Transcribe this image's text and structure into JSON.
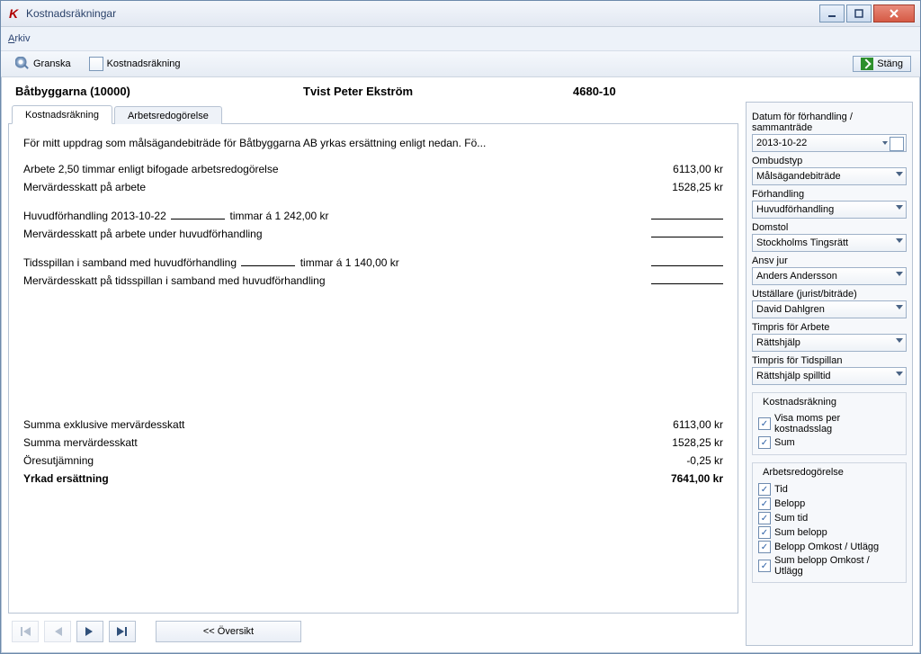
{
  "window": {
    "title": "Kostnadsräkningar"
  },
  "menu": {
    "arkiv": "Arkiv"
  },
  "toolbar": {
    "granska": "Granska",
    "kostnadsrakning": "Kostnadsräkning",
    "stang": "Stäng"
  },
  "header": {
    "client": "Båtbyggarna (10000)",
    "case": "Tvist Peter Ekström",
    "caseno": "4680-10"
  },
  "tabs": {
    "t1": "Kostnadsräkning",
    "t2": "Arbetsredogörelse"
  },
  "doc": {
    "intro": "För mitt uppdrag som målsägandebiträde för Båtbyggarna AB yrkas ersättning enligt nedan. Fö...",
    "r1l": "Arbete 2,50 timmar enligt bifogade arbetsredogörelse",
    "r1a": "6113,00 kr",
    "r2l": "Mervärdesskatt på arbete",
    "r2a": "1528,25 kr",
    "r3l_a": "Huvudförhandling 2013-10-22",
    "r3l_b": "timmar á 1 242,00 kr",
    "r4l": "Mervärdesskatt på arbete under huvudförhandling",
    "r5l_a": "Tidsspillan i samband med huvudförhandling",
    "r5l_b": "timmar á 1 140,00 kr",
    "r6l": "Mervärdesskatt på tidsspillan i samband med huvudförhandling",
    "s1l": "Summa exklusive mervärdesskatt",
    "s1a": "6113,00 kr",
    "s2l": "Summa mervärdesskatt",
    "s2a": "1528,25 kr",
    "s3l": "Öresutjämning",
    "s3a": "-0,25 kr",
    "s4l": "Yrkad ersättning",
    "s4a": "7641,00 kr"
  },
  "bottom": {
    "oversikt": "<< Översikt"
  },
  "side": {
    "lbl_datum": "Datum för förhandling / sammanträde",
    "val_datum": "2013-10-22",
    "lbl_ombud": "Ombudstyp",
    "val_ombud": "Målsägandebiträde",
    "lbl_forh": "Förhandling",
    "val_forh": "Huvudförhandling",
    "lbl_domstol": "Domstol",
    "val_domstol": "Stockholms Tingsrätt",
    "lbl_ansv": "Ansv jur",
    "val_ansv": "Anders Andersson",
    "lbl_utst": "Utställare (jurist/biträde)",
    "val_utst": "David Dahlgren",
    "lbl_tparb": "Timpris för Arbete",
    "val_tparb": "Rättshjälp",
    "lbl_tpsp": "Timpris för Tidspillan",
    "val_tpsp": "Rättshjälp spilltid",
    "grp_kost": "Kostnadsräkning",
    "chk_visa": "Visa moms per kostnadsslag",
    "chk_sum": "Sum",
    "grp_arb": "Arbetsredogörelse",
    "chk_tid": "Tid",
    "chk_belopp": "Belopp",
    "chk_sumtid": "Sum tid",
    "chk_sumbel": "Sum belopp",
    "chk_ombu": "Belopp Omkost / Utlägg",
    "chk_sombu": "Sum belopp Omkost / Utlägg"
  }
}
